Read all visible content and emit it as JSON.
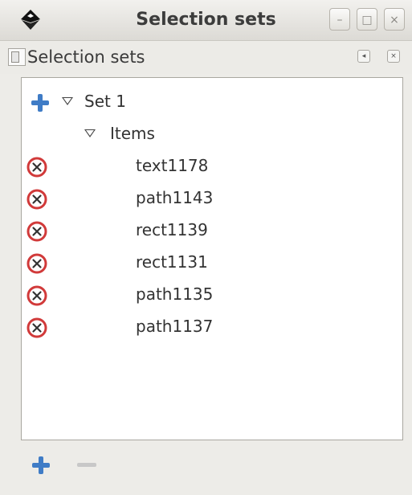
{
  "window": {
    "title": "Selection sets",
    "buttons": [
      "minimize",
      "maximize",
      "close"
    ]
  },
  "dock": {
    "title": "Selection sets"
  },
  "tree": {
    "set": {
      "label": "Set 1"
    },
    "group": {
      "label": "Items"
    },
    "items": [
      {
        "label": "text1178"
      },
      {
        "label": "path1143"
      },
      {
        "label": "rect1139"
      },
      {
        "label": "rect1131"
      },
      {
        "label": "path1135"
      },
      {
        "label": "path1137"
      }
    ]
  },
  "icons": {
    "add": "plus-icon",
    "remove": "remove-icon",
    "expand": "triangle-down-icon"
  },
  "colors": {
    "accent_blue": "#3f7cc6",
    "remove_red": "#d13a3a"
  }
}
